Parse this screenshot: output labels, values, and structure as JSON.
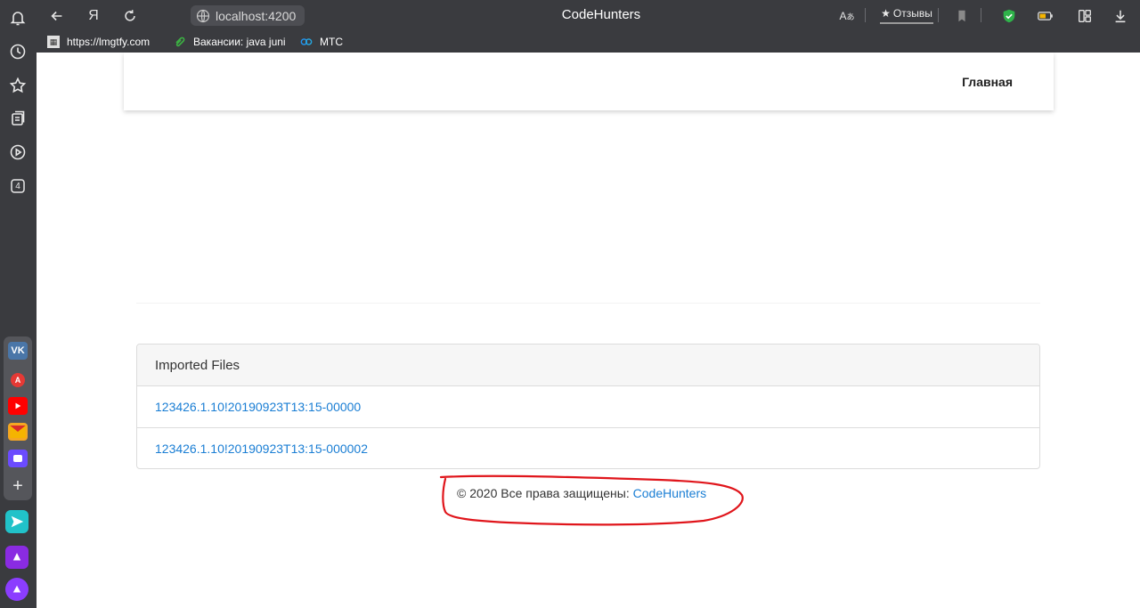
{
  "browser": {
    "address": "localhost:4200",
    "title": "CodeHunters",
    "reviews_label": "Отзывы",
    "bookmarks": [
      {
        "label": "https://lmgtfy.com"
      },
      {
        "label": "Вакансии: java juni"
      },
      {
        "label": "МТС"
      }
    ],
    "sidebar_tab_count": "4"
  },
  "nav": {
    "home_label": "Главная"
  },
  "files_card": {
    "header": "Imported Files",
    "items": [
      "123426.1.10!20190923T13:15-00000",
      "123426.1.10!20190923T13:15-000002"
    ]
  },
  "footer": {
    "prefix": "© 2020 Все права защищены: ",
    "link": "CodeHunters"
  },
  "colors": {
    "chrome": "#3a3b3f",
    "link": "#1a7ed4",
    "annotation": "#e0151b"
  }
}
